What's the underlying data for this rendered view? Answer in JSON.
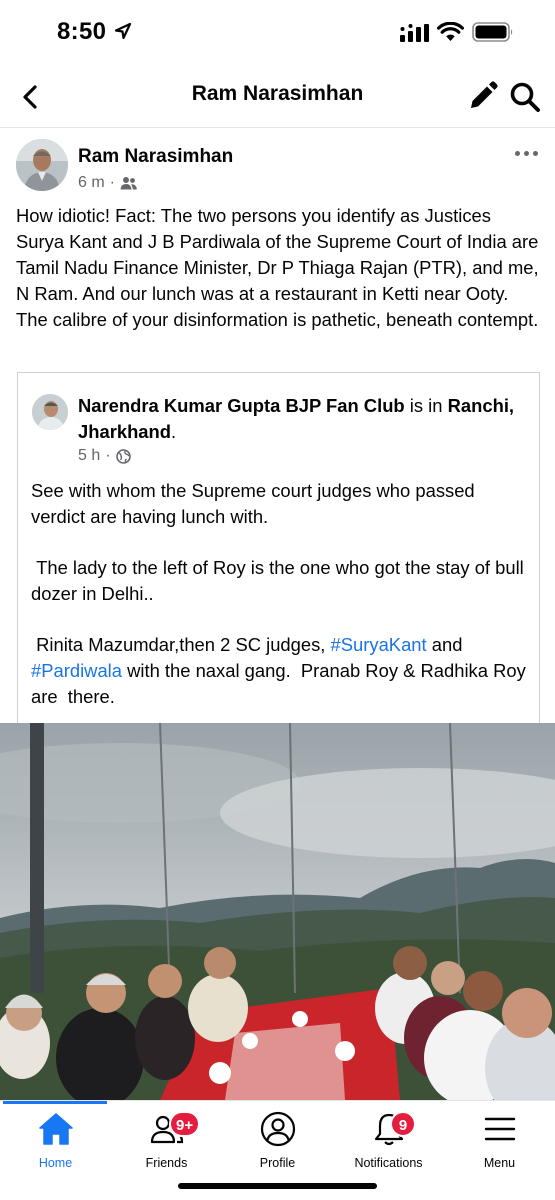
{
  "status_bar": {
    "time": "8:50"
  },
  "header": {
    "title": "Ram Narasimhan"
  },
  "post": {
    "author": "Ram Narasimhan",
    "time": "6 m",
    "audience_icon": "friends-icon",
    "text": "How idiotic! Fact: The two persons you identify as Justices Surya Kant and J B Pardiwala of the Supreme Court of India are Tamil Nadu Finance Minister, Dr P Thiaga Rajan (PTR), and me, N Ram. And our lunch was at a restaurant in Ketti near Ooty. The calibre of your disinformation is pathetic, beneath contempt."
  },
  "shared": {
    "author": "Narendra Kumar Gupta BJP Fan Club",
    "connector": " is in ",
    "location": "Ranchi, Jharkhand",
    "period": ".",
    "time": "5 h",
    "audience_icon": "globe-icon",
    "para1": "See with whom the Supreme court judges who passed verdict are having lunch with.",
    "para2": " The lady to the left of Roy is the one who got the stay of bull dozer in Delhi..",
    "para3_a": " Rinita Mazumdar,then 2 SC judges, ",
    "hashtag1": "#SuryaKant",
    "para3_b": " and ",
    "hashtag2": "#Pardiwala",
    "para3_c": " with the naxal gang.  Pranab Roy & Radhika Roy are  there."
  },
  "tabs": {
    "home": "Home",
    "friends": "Friends",
    "friends_badge": "9+",
    "profile": "Profile",
    "notifications": "Notifications",
    "notifications_badge": "9",
    "menu": "Menu"
  },
  "colors": {
    "accent": "#1877f2",
    "badge": "#e41e3f",
    "hashtag": "#1b74e4",
    "meta": "#65676b"
  }
}
